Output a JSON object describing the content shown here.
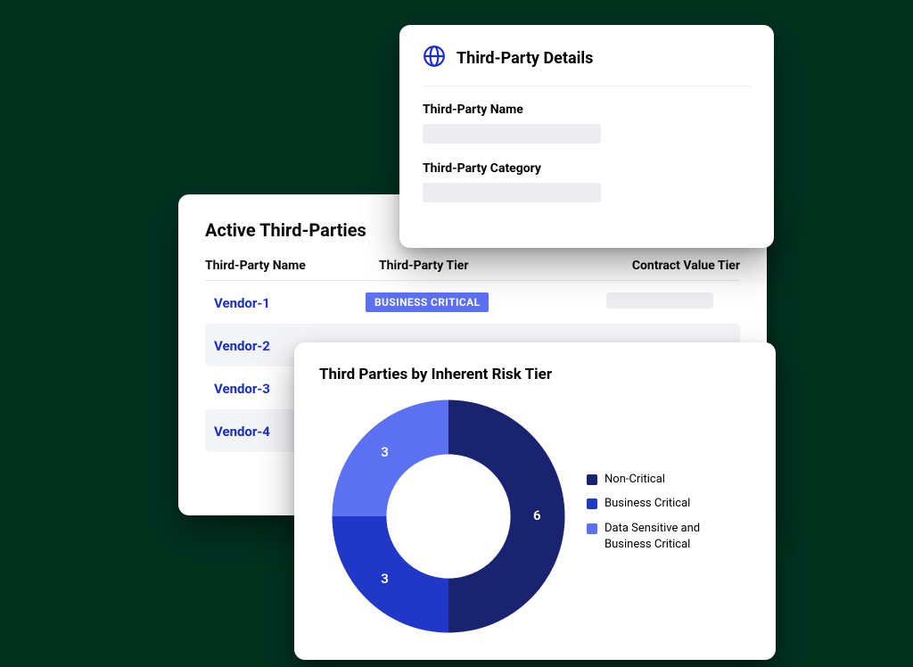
{
  "active_card": {
    "title": "Active Third-Parties",
    "columns": {
      "name": "Third-Party Name",
      "tier": "Third-Party Tier",
      "cv": "Contract Value Tier"
    },
    "rows": [
      {
        "name": "Vendor-1",
        "tier_badge": "BUSINESS CRITICAL"
      },
      {
        "name": "Vendor-2"
      },
      {
        "name": "Vendor-3"
      },
      {
        "name": "Vendor-4"
      }
    ]
  },
  "details_card": {
    "title": "Third-Party Details",
    "field1_label": "Third-Party Name",
    "field2_label": "Third-Party Category"
  },
  "chart_card": {
    "title": "Third Parties by Inherent Risk Tier"
  },
  "chart_data": {
    "type": "pie",
    "title": "Third Parties by Inherent Risk Tier",
    "series": [
      {
        "name": "Non-Critical",
        "value": 6,
        "color": "#1a2370"
      },
      {
        "name": "Business Critical",
        "value": 3,
        "color": "#2037c7"
      },
      {
        "name": "Data Sensitive and Business Critical",
        "value": 3,
        "color": "#5c70f2"
      }
    ]
  },
  "colors": {
    "accent": "#1a2fc9",
    "pill": "#5c70f2"
  }
}
